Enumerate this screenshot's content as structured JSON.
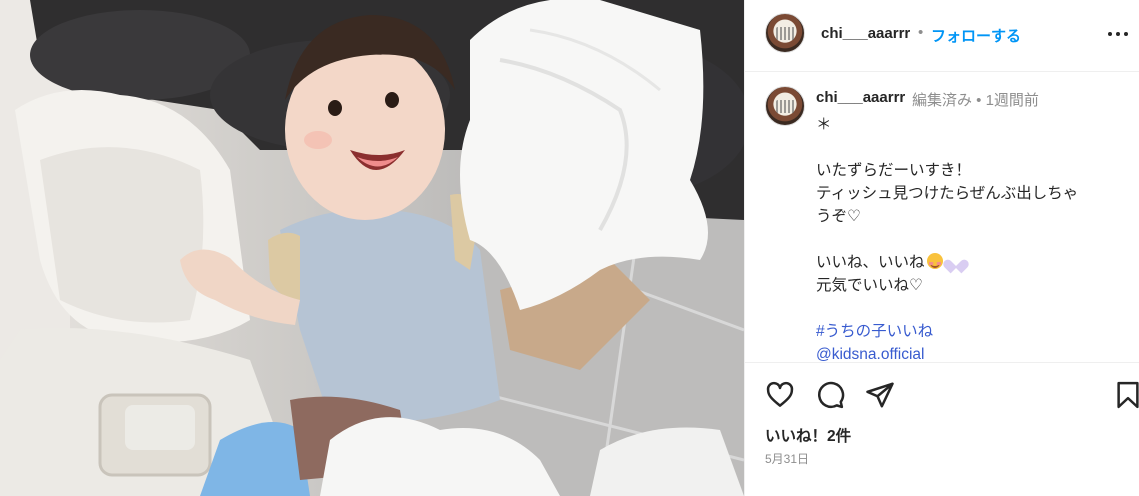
{
  "colors": {
    "accent": "#0095f6",
    "link": "#385bcf",
    "muted": "#8e8e8e",
    "text": "#262626",
    "divider": "#efefef"
  },
  "header": {
    "username": "chi___aaarrr",
    "separator": "•",
    "follow_label": "フォローする",
    "more_icon": "more-horizontal-icon"
  },
  "caption": {
    "username": "chi___aaarrr",
    "meta": "編集済み • 1週間前",
    "lines": [
      "＊",
      "",
      "いたずらだーいすき！",
      "ティッシュ見つけたらぜんぶ出しちゃ",
      "うぞ♡",
      "",
      "いいね、いいね",
      "元気でいいね♡",
      "",
      "#うちの子いいね",
      "@kidsna.official"
    ]
  },
  "actions": {
    "like_icon": "heart-outline-icon",
    "comment_icon": "comment-icon",
    "share_icon": "paper-plane-icon",
    "save_icon": "bookmark-icon"
  },
  "likes_label": "いいね！2件",
  "date_label": "5月31日"
}
